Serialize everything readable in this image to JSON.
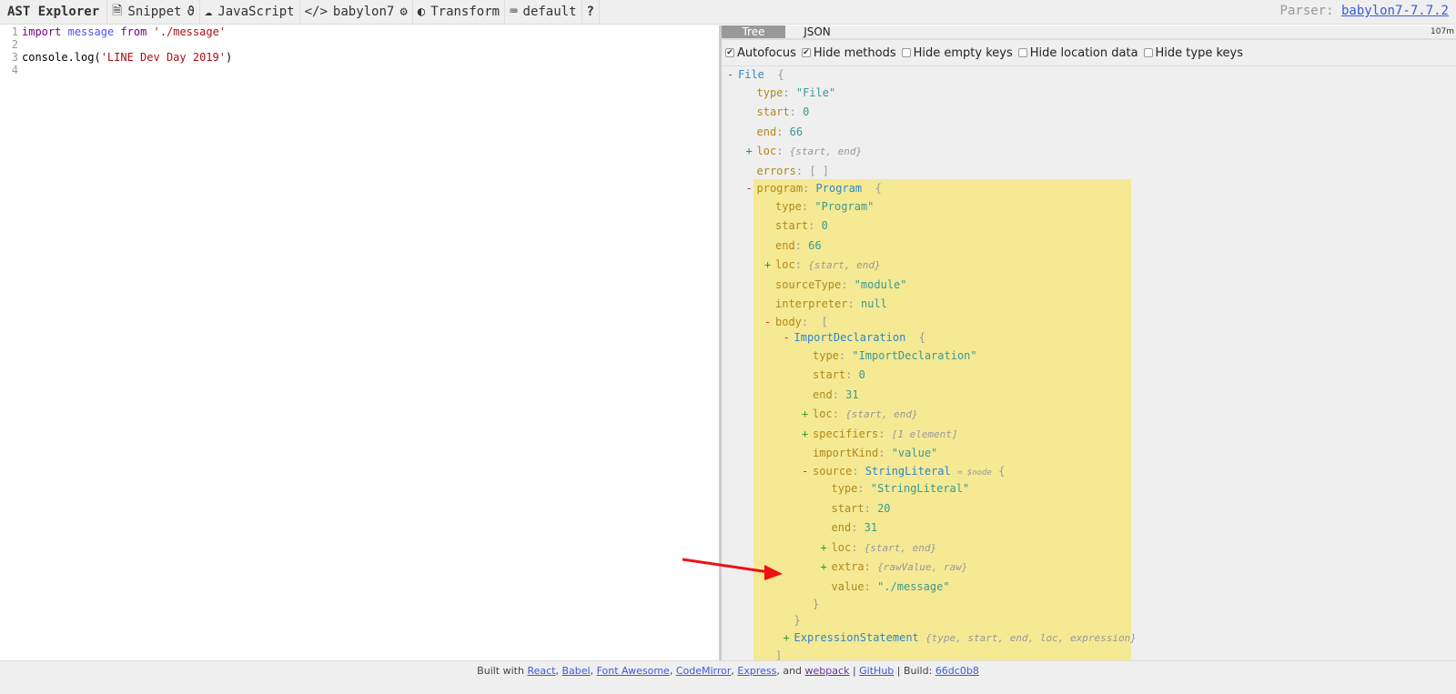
{
  "toolbar": {
    "brand": "AST Explorer",
    "snippet": "Snippet",
    "language": "JavaScript",
    "parser": "babylon7",
    "transform": "Transform",
    "keymap": "default",
    "help": "?",
    "parser_label": "Parser:",
    "parser_version": "babylon7-7.7.2"
  },
  "editor": {
    "lines": [
      {
        "n": "1",
        "tokens": [
          {
            "t": "import",
            "c": "kw"
          },
          {
            "t": " "
          },
          {
            "t": "message",
            "c": "var"
          },
          {
            "t": " "
          },
          {
            "t": "from",
            "c": "kw"
          },
          {
            "t": " "
          },
          {
            "t": "'./message'",
            "c": "str"
          }
        ]
      },
      {
        "n": "2",
        "tokens": []
      },
      {
        "n": "3",
        "tokens": [
          {
            "t": "console.log("
          },
          {
            "t": "'LINE Dev Day 2019'",
            "c": "str"
          },
          {
            "t": ")"
          }
        ]
      },
      {
        "n": "4",
        "tokens": []
      }
    ]
  },
  "panel": {
    "tabs": [
      "Tree",
      "JSON"
    ],
    "active_tab": "Tree",
    "time": "107m",
    "options": [
      {
        "label": "Autofocus",
        "checked": true
      },
      {
        "label": "Hide methods",
        "checked": true
      },
      {
        "label": "Hide empty keys",
        "checked": false
      },
      {
        "label": "Hide location data",
        "checked": false
      },
      {
        "label": "Hide type keys",
        "checked": false
      }
    ]
  },
  "tree": [
    {
      "h": "o",
      "d": 0,
      "m": "-",
      "t": "File",
      "b": " {"
    },
    {
      "h": "p",
      "d": 1,
      "k": "type",
      "v": "\"File\"",
      "vk": "vstr"
    },
    {
      "h": "p",
      "d": 1,
      "k": "start",
      "v": "0",
      "vk": "vnum"
    },
    {
      "h": "p",
      "d": 1,
      "k": "end",
      "v": "66",
      "vk": "vnum"
    },
    {
      "h": "p",
      "d": 1,
      "m": "+",
      "k": "loc",
      "s": "{start, end}"
    },
    {
      "h": "p",
      "d": 1,
      "k": "errors",
      "v": "[ ]",
      "vk": "br"
    },
    {
      "h": "o",
      "d": 1,
      "m": "-",
      "k": "program",
      "t": "Program",
      "b": " {"
    },
    {
      "h": "p",
      "d": 2,
      "k": "type",
      "v": "\"Program\"",
      "vk": "vstr"
    },
    {
      "h": "p",
      "d": 2,
      "k": "start",
      "v": "0",
      "vk": "vnum"
    },
    {
      "h": "p",
      "d": 2,
      "k": "end",
      "v": "66",
      "vk": "vnum"
    },
    {
      "h": "p",
      "d": 2,
      "m": "+",
      "k": "loc",
      "s": "{start, end}"
    },
    {
      "h": "p",
      "d": 2,
      "k": "sourceType",
      "v": "\"module\"",
      "vk": "vstr"
    },
    {
      "h": "p",
      "d": 2,
      "k": "interpreter",
      "v": "null",
      "vk": "vnum"
    },
    {
      "h": "o",
      "d": 2,
      "m": "-",
      "k": "body",
      "b": " ["
    },
    {
      "h": "o",
      "d": 3,
      "m": "-",
      "t": "ImportDeclaration",
      "b": " {"
    },
    {
      "h": "p",
      "d": 4,
      "k": "type",
      "v": "\"ImportDeclaration\"",
      "vk": "vstr"
    },
    {
      "h": "p",
      "d": 4,
      "k": "start",
      "v": "0",
      "vk": "vnum"
    },
    {
      "h": "p",
      "d": 4,
      "k": "end",
      "v": "31",
      "vk": "vnum"
    },
    {
      "h": "p",
      "d": 4,
      "m": "+",
      "k": "loc",
      "s": "{start, end}"
    },
    {
      "h": "p",
      "d": 4,
      "m": "+",
      "k": "specifiers",
      "s": "[1 element]"
    },
    {
      "h": "p",
      "d": 4,
      "k": "importKind",
      "v": "\"value\"",
      "vk": "vstr"
    },
    {
      "h": "o",
      "d": 4,
      "m": "-",
      "k": "source",
      "t": "StringLiteral",
      "n": "= $node",
      "b": "{"
    },
    {
      "h": "p",
      "d": 5,
      "k": "type",
      "v": "\"StringLiteral\"",
      "vk": "vstr"
    },
    {
      "h": "p",
      "d": 5,
      "k": "start",
      "v": "20",
      "vk": "vnum"
    },
    {
      "h": "p",
      "d": 5,
      "k": "end",
      "v": "31",
      "vk": "vnum"
    },
    {
      "h": "p",
      "d": 5,
      "m": "+",
      "k": "loc",
      "s": "{start, end}"
    },
    {
      "h": "p",
      "d": 5,
      "m": "+",
      "k": "extra",
      "s": "{rawValue, raw}"
    },
    {
      "h": "p",
      "d": 5,
      "k": "value",
      "v": "\"./message\"",
      "vk": "vstr"
    },
    {
      "h": "o",
      "d": 4,
      "b": "}"
    },
    {
      "h": "o",
      "d": 3,
      "b": "}"
    },
    {
      "h": "p",
      "d": 3,
      "m": "+",
      "t": "ExpressionStatement",
      "s": "{type, start, end, loc, expression}"
    },
    {
      "h": "o",
      "d": 2,
      "b": "]"
    }
  ],
  "footer": {
    "prefix": "Built with",
    "links": [
      "React",
      "Babel",
      "Font Awesome",
      "CodeMirror",
      "Express"
    ],
    "and": ", and",
    "webpack": "webpack",
    "sep": "|",
    "github": "GitHub",
    "build_label": "| Build:",
    "build": "66dc0b8"
  },
  "colors": {
    "highlight": "#f5e994",
    "annotation_arrow": "#ee1111"
  }
}
